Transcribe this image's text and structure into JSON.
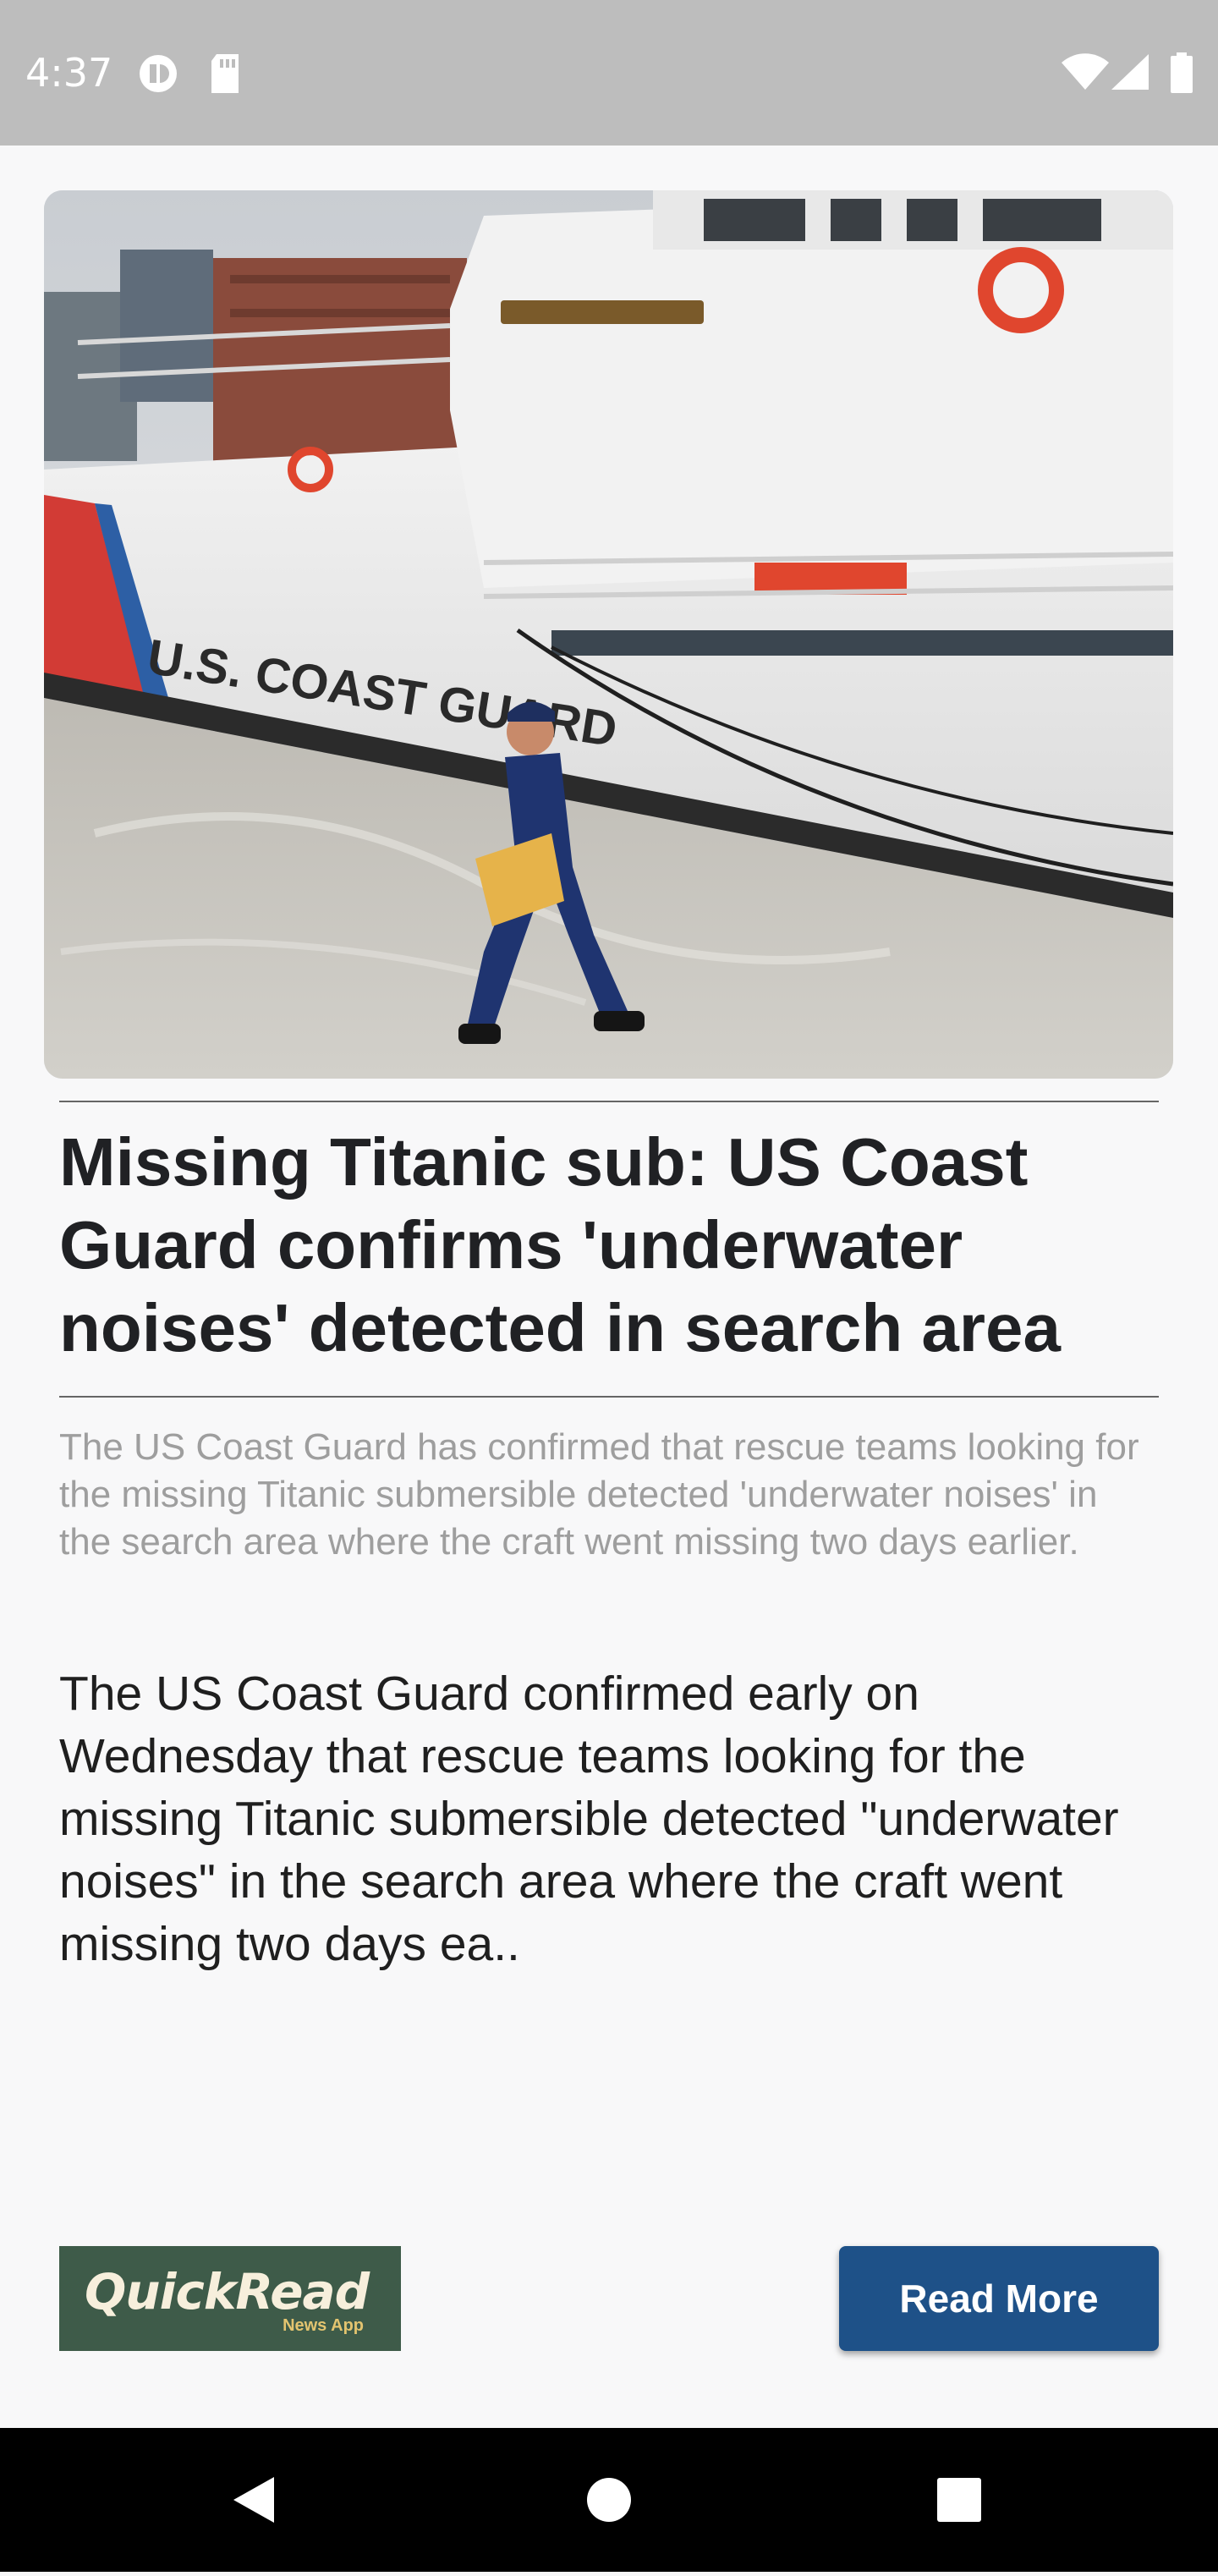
{
  "status_bar": {
    "time": "4:37",
    "left_icons": [
      "vpn-key-icon",
      "sd-card-icon"
    ],
    "right_icons": [
      "wifi-icon",
      "cellular-signal-icon",
      "battery-icon"
    ]
  },
  "article": {
    "image_alt_icon": "coast-guard-ship-photo",
    "headline": "Missing Titanic sub: US Coast Guard confirms 'underwater noises' detected in search area",
    "summary": "The US Coast Guard has confirmed that rescue teams looking for the missing Titanic submersible detected 'underwater noises' in the search area where the craft went missing two days earlier.",
    "body": "The US Coast Guard confirmed early on Wednesday that rescue teams looking for the missing Titanic submersible detected \"underwater noises\" in the search area where the craft went missing two days ea.."
  },
  "footer": {
    "logo_text": "QuickRead",
    "logo_subtext": "News App",
    "read_more_label": "Read More"
  },
  "nav_bar": {
    "icons": [
      "back-icon",
      "home-icon",
      "recents-icon"
    ]
  },
  "colors": {
    "status_bar_bg": "#bdbdbd",
    "logo_bg": "#3e5b49",
    "button_bg": "#1e5188",
    "nav_bg": "#000000"
  }
}
